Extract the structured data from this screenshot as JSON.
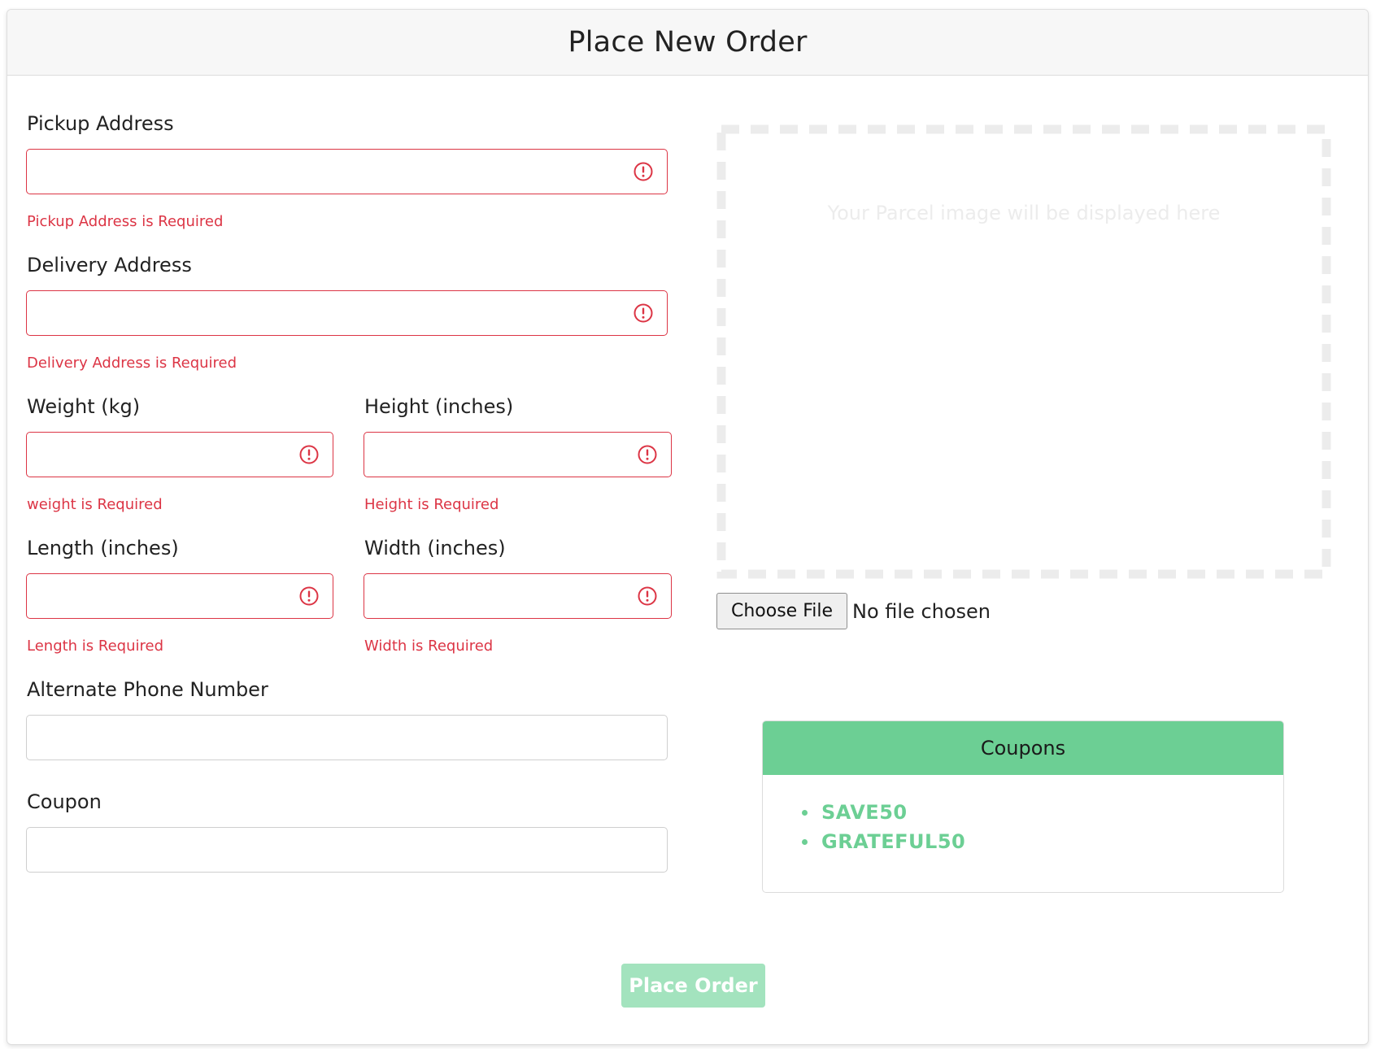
{
  "header": {
    "title": "Place New Order"
  },
  "form": {
    "pickup": {
      "label": "Pickup Address",
      "value": "",
      "error": "Pickup Address is Required"
    },
    "delivery": {
      "label": "Delivery Address",
      "value": "",
      "error": "Delivery Address is Required"
    },
    "weight": {
      "label": "Weight (kg)",
      "value": "",
      "error": "weight is Required"
    },
    "height": {
      "label": "Height (inches)",
      "value": "",
      "error": "Height is Required"
    },
    "length": {
      "label": "Length (inches)",
      "value": "",
      "error": "Length is Required"
    },
    "width": {
      "label": "Width (inches)",
      "value": "",
      "error": "Width is Required"
    },
    "phone": {
      "label": "Alternate Phone Number",
      "value": ""
    },
    "coupon": {
      "label": "Coupon",
      "value": ""
    }
  },
  "upload": {
    "placeholder_text": "Your Parcel image will be displayed here",
    "choose_label": "Choose File",
    "status": "No file chosen"
  },
  "coupons": {
    "title": "Coupons",
    "items": [
      "SAVE50",
      "GRATEFUL50"
    ]
  },
  "submit": {
    "label": "Place Order",
    "disabled": true
  },
  "colors": {
    "error": "#dc3545",
    "accent": "#6ccf94",
    "button_disabled": "#a3e3be"
  },
  "icons": {
    "field_error": "exclamation-circle-icon",
    "coupon_bullet": "bullet-dot-icon"
  }
}
